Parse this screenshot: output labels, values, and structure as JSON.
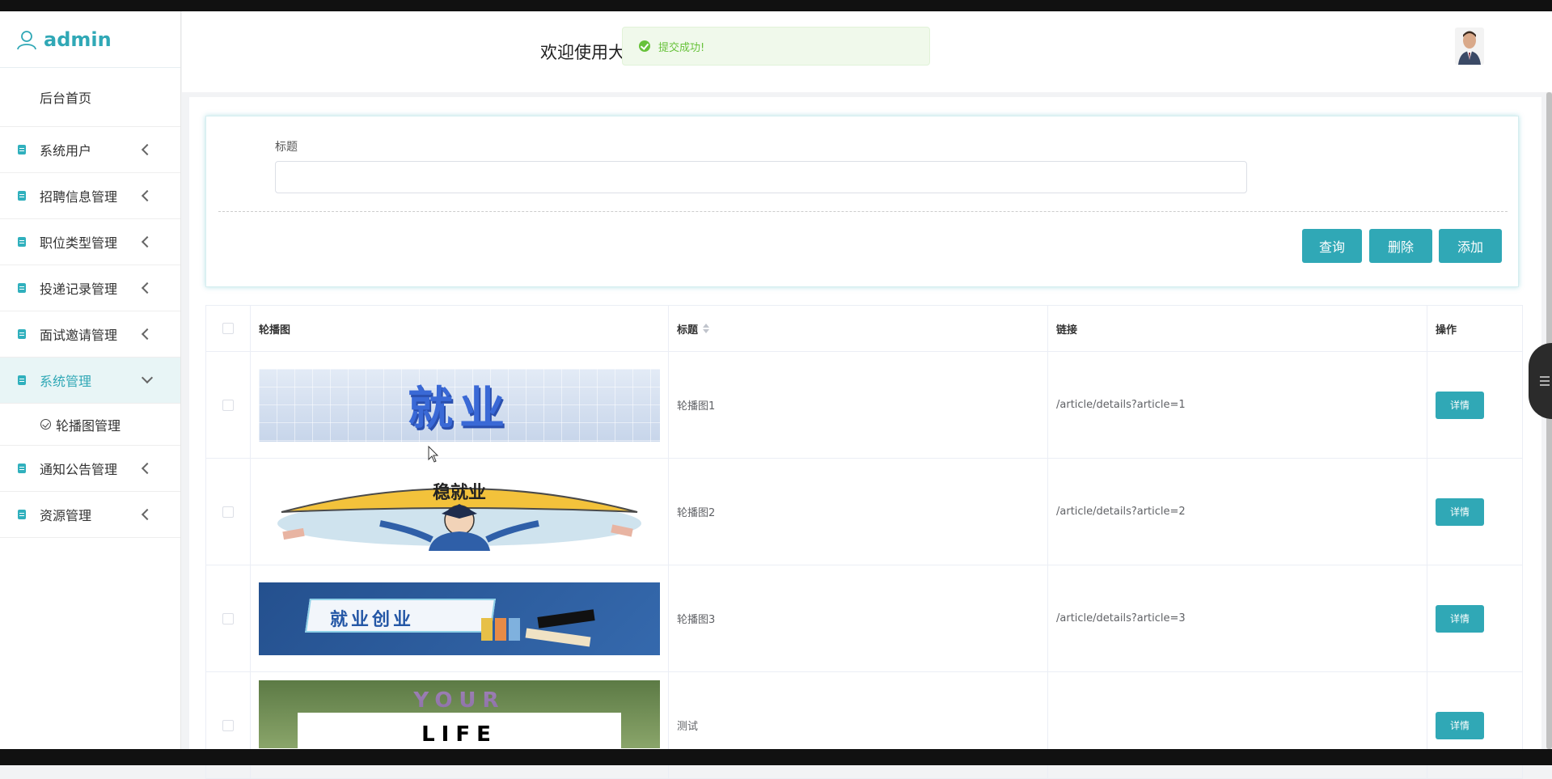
{
  "brand": {
    "name": "admin"
  },
  "sidebar": {
    "home": "后台首页",
    "items": [
      {
        "label": "系统用户"
      },
      {
        "label": "招聘信息管理"
      },
      {
        "label": "职位类型管理"
      },
      {
        "label": "投递记录管理"
      },
      {
        "label": "面试邀请管理"
      },
      {
        "label": "系统管理"
      },
      {
        "label": "通知公告管理"
      },
      {
        "label": "资源管理"
      }
    ],
    "submenu": "轮播图管理"
  },
  "header": {
    "welcome": "欢迎使用大"
  },
  "toast": {
    "message": "提交成功!"
  },
  "search": {
    "label": "标题",
    "value": ""
  },
  "actions": {
    "query": "查询",
    "delete": "删除",
    "add": "添加"
  },
  "table": {
    "headers": {
      "image": "轮播图",
      "title": "标题",
      "link": "链接",
      "op": "操作"
    },
    "rows": [
      {
        "title": "轮播图1",
        "link": "/article/details?article=1",
        "op": "详情",
        "banner_text": "就业"
      },
      {
        "title": "轮播图2",
        "link": "/article/details?article=2",
        "op": "详情",
        "banner_text": "稳就业"
      },
      {
        "title": "轮播图3",
        "link": "/article/details?article=3",
        "op": "详情",
        "banner_text": "就业创业"
      },
      {
        "title": "测试",
        "link": "",
        "op": "详情",
        "banner_text": "YOUR LIFE"
      }
    ]
  },
  "colors": {
    "accent": "#30a8b6",
    "success": "#67c23a"
  }
}
